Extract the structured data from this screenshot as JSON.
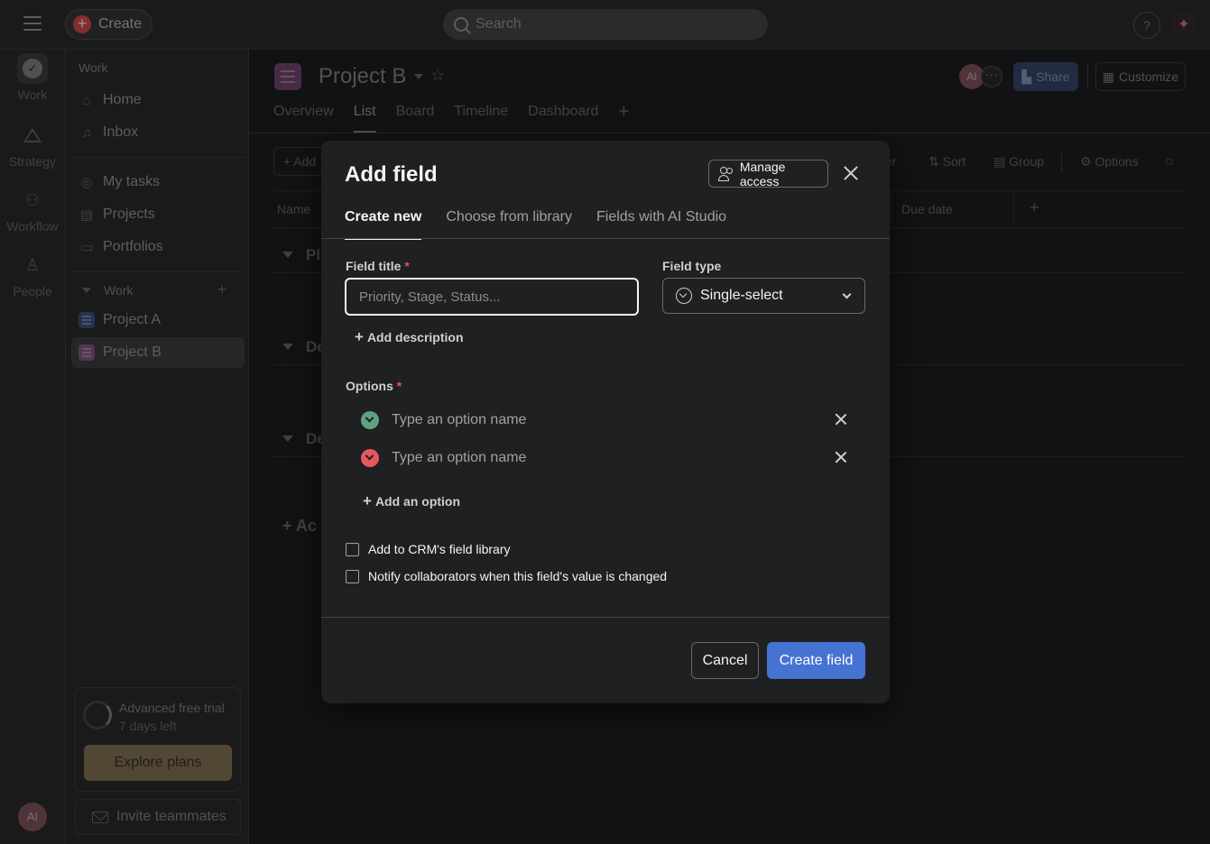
{
  "topbar": {
    "create_label": "Create",
    "search_placeholder": "Search",
    "help_label": "?",
    "ai_label": "✦"
  },
  "rail": {
    "items": [
      {
        "label": "Work",
        "icon": "check-circle-icon"
      },
      {
        "label": "Strategy",
        "icon": "triangle-icon"
      },
      {
        "label": "Workflow",
        "icon": "workflow-icon"
      },
      {
        "label": "People",
        "icon": "people-icon"
      }
    ],
    "avatar_initials": "AI"
  },
  "sidebar": {
    "section_title": "Work",
    "nav": [
      {
        "label": "Home",
        "icon": "home-icon"
      },
      {
        "label": "Inbox",
        "icon": "bell-icon"
      }
    ],
    "nav2": [
      {
        "label": "My tasks",
        "icon": "check-circle-icon"
      },
      {
        "label": "Projects",
        "icon": "clipboard-icon"
      },
      {
        "label": "Portfolios",
        "icon": "folder-icon"
      }
    ],
    "team_heading": "Work",
    "projects": [
      {
        "label": "Project A",
        "color": "#4573d2"
      },
      {
        "label": "Project B",
        "color": "#c76ec1"
      }
    ],
    "trial": {
      "title": "Advanced free trial",
      "subtitle": "7 days left",
      "button": "Explore plans"
    },
    "invite_label": "Invite teammates"
  },
  "project": {
    "title": "Project B",
    "avatar_initials": "AI",
    "more_label": "···",
    "share_label": "Share",
    "customize_label": "Customize",
    "tabs": [
      "Overview",
      "List",
      "Board",
      "Timeline",
      "Dashboard"
    ],
    "active_tab": "List",
    "toolbar": {
      "add_task": "+ Add",
      "filter_partial": "er",
      "sort": "Sort",
      "group": "Group",
      "options": "Options"
    },
    "columns": {
      "name": "Name",
      "due": "Due date"
    },
    "sections": [
      "Pl",
      "De",
      "De"
    ],
    "add_section": "+ Ac"
  },
  "modal": {
    "title": "Add field",
    "manage_access": "Manage access",
    "tabs": [
      "Create new",
      "Choose from library",
      "Fields with AI Studio"
    ],
    "field_title_label": "Field title",
    "field_title_placeholder": "Priority, Stage, Status...",
    "field_title_value": "",
    "field_type_label": "Field type",
    "field_type_value": "Single-select",
    "add_description": "Add description",
    "options_label": "Options",
    "required_mark": "*",
    "options": [
      {
        "placeholder": "Type an option name",
        "value": "",
        "color": "#5da283"
      },
      {
        "placeholder": "Type an option name",
        "value": "",
        "color": "#e8585e"
      }
    ],
    "add_option": "Add an option",
    "checkboxes": [
      {
        "label": "Add to CRM's field library",
        "checked": false
      },
      {
        "label": "Notify collaborators when this field's value is changed",
        "checked": false
      }
    ],
    "cancel": "Cancel",
    "create_field": "Create field"
  }
}
